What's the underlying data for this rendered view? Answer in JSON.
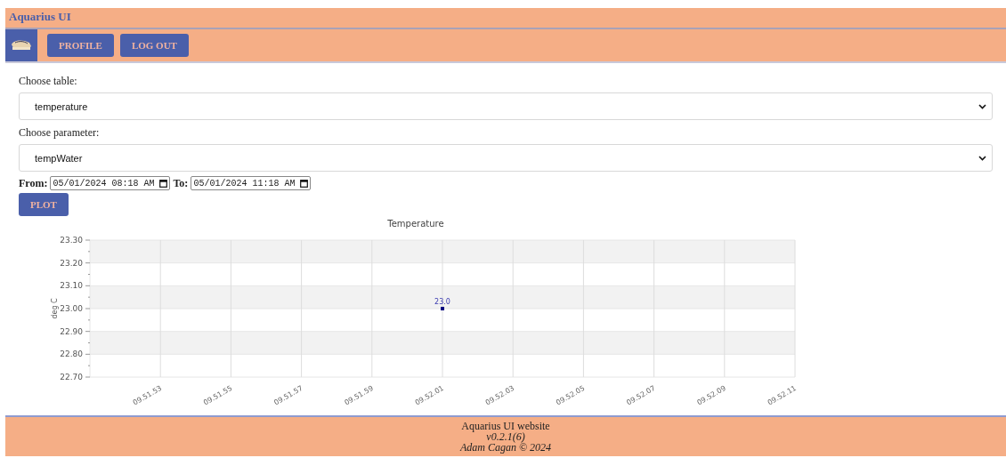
{
  "header": {
    "title": "Aquarius UI"
  },
  "nav": {
    "buttons": [
      "PROFILE",
      "LOG OUT"
    ]
  },
  "form": {
    "table_label": "Choose table:",
    "table_value": "temperature",
    "parameter_label": "Choose parameter:",
    "parameter_value": "tempWater",
    "from_label": "From:",
    "from_value": "05/01/2024 08:18 AM",
    "to_label": "To:",
    "to_value": "05/01/2024 11:18 AM",
    "plot_button": "PLOT"
  },
  "chart": {
    "chart_data": {
      "type": "scatter",
      "title": "Temperature",
      "ylabel": "deg C",
      "categories": [
        "09.51.53",
        "09.51.55",
        "09.51.57",
        "09.51.59",
        "09.52.01",
        "09.52.03",
        "09.52.05",
        "09.52.07",
        "09.52.09",
        "09.52.11"
      ],
      "grid": true,
      "series": [
        {
          "color": "#000080",
          "values": [
            null,
            null,
            null,
            null,
            23.0,
            null,
            null,
            null,
            null,
            null
          ]
        }
      ],
      "ylim": [
        22.7,
        23.3
      ],
      "yticks": [
        {
          "value": 22.7,
          "label": "22.70"
        },
        {
          "value": 22.8,
          "label": "22.80"
        },
        {
          "value": 22.9,
          "label": "22.90"
        },
        {
          "value": 23.0,
          "label": "23.00"
        },
        {
          "value": 23.1,
          "label": "23.10"
        },
        {
          "value": 23.2,
          "label": "23.20"
        },
        {
          "value": 23.3,
          "label": "23.30"
        }
      ],
      "value_labels": [
        "23.0"
      ]
    }
  },
  "footer": {
    "lines": [
      "Aquarius UI website",
      "v0.2.1(6)",
      "Adam Cagan © 2024"
    ]
  }
}
